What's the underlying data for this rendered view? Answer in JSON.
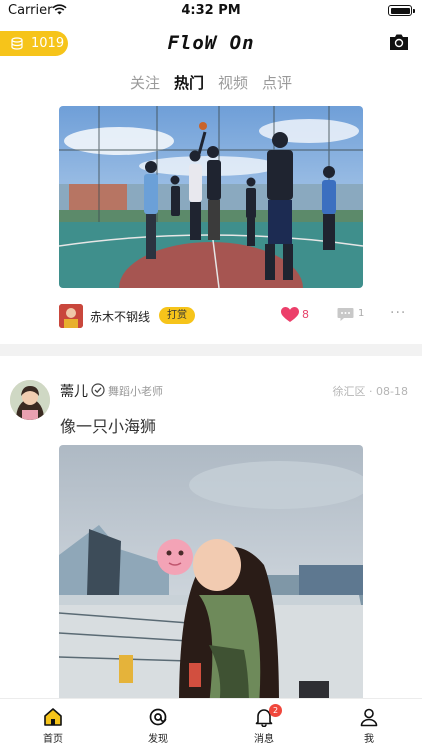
{
  "status_bar": {
    "carrier": "Carrier",
    "time": "4:32 PM"
  },
  "header": {
    "coin_balance": "1019",
    "app_title": "FloW On",
    "accent_color": "#f6c41a"
  },
  "tabs": [
    {
      "label": "关注",
      "active": false
    },
    {
      "label": "热门",
      "active": true
    },
    {
      "label": "视频",
      "active": false
    },
    {
      "label": "点评",
      "active": false
    }
  ],
  "post1": {
    "author": "赤木不钢线",
    "tip_label": "打赏",
    "likes": "8",
    "comments": "1"
  },
  "post2": {
    "author": "薷儿",
    "tag": "舞蹈小老师",
    "location": "徐汇区",
    "date": "08-18",
    "text": "像一只小海狮"
  },
  "tabbar": [
    {
      "label": "首页",
      "icon": "home-icon"
    },
    {
      "label": "发现",
      "icon": "discover-icon"
    },
    {
      "label": "消息",
      "icon": "bell-icon",
      "badge": "2"
    },
    {
      "label": "我",
      "icon": "user-icon"
    }
  ]
}
